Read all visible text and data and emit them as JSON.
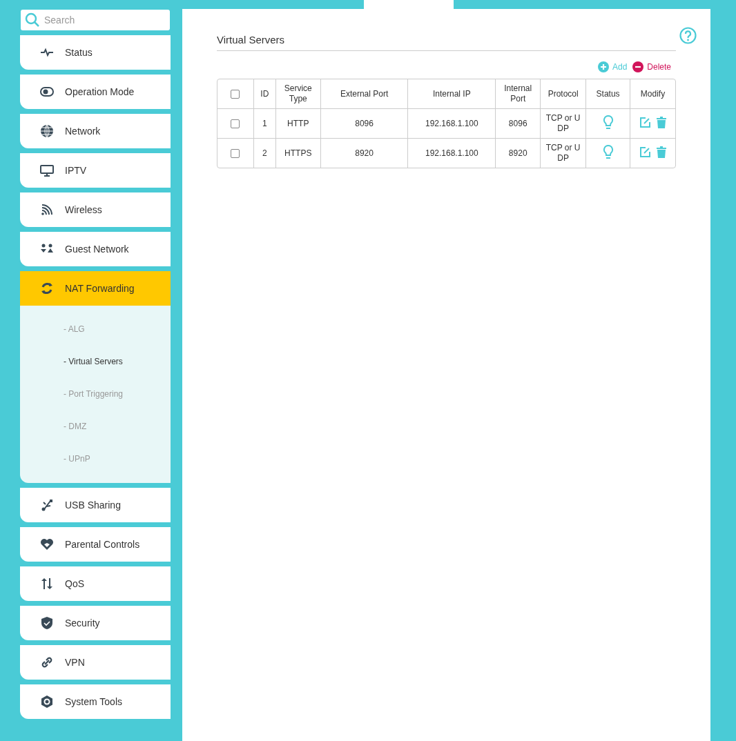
{
  "search": {
    "placeholder": "Search"
  },
  "sidebar": {
    "items": [
      {
        "label": "Status",
        "selected": false
      },
      {
        "label": "Operation Mode",
        "selected": false
      },
      {
        "label": "Network",
        "selected": false
      },
      {
        "label": "IPTV",
        "selected": false
      },
      {
        "label": "Wireless",
        "selected": false
      },
      {
        "label": "Guest Network",
        "selected": false
      },
      {
        "label": "NAT Forwarding",
        "selected": true,
        "expanded": true,
        "children": [
          {
            "label": "- ALG",
            "selected": false
          },
          {
            "label": "- Virtual Servers",
            "selected": true
          },
          {
            "label": "- Port Triggering",
            "selected": false
          },
          {
            "label": "- DMZ",
            "selected": false
          },
          {
            "label": "- UPnP",
            "selected": false
          }
        ]
      },
      {
        "label": "USB Sharing",
        "selected": false
      },
      {
        "label": "Parental Controls",
        "selected": false
      },
      {
        "label": "QoS",
        "selected": false
      },
      {
        "label": "Security",
        "selected": false
      },
      {
        "label": "VPN",
        "selected": false
      },
      {
        "label": "System Tools",
        "selected": false
      }
    ]
  },
  "section": {
    "title": "Virtual Servers",
    "actions": [
      {
        "kind": "add",
        "label": "Add"
      },
      {
        "kind": "delete",
        "label": "Delete"
      }
    ]
  },
  "table": {
    "select_all": {
      "checked": false
    },
    "columns": [
      "ID",
      "Service Type",
      "External Port",
      "Internal IP",
      "Internal Port",
      "Protocol",
      "Status",
      "Modify"
    ],
    "rows": [
      {
        "checked": false,
        "cells": [
          "1",
          "HTTP",
          "8096",
          "192.168.1.100",
          "8096",
          "TCP or U DP"
        ],
        "on": true
      },
      {
        "checked": false,
        "cells": [
          "2",
          "HTTPS",
          "8920",
          "192.168.1.100",
          "8920",
          "TCP or U DP"
        ],
        "on": true
      }
    ]
  }
}
